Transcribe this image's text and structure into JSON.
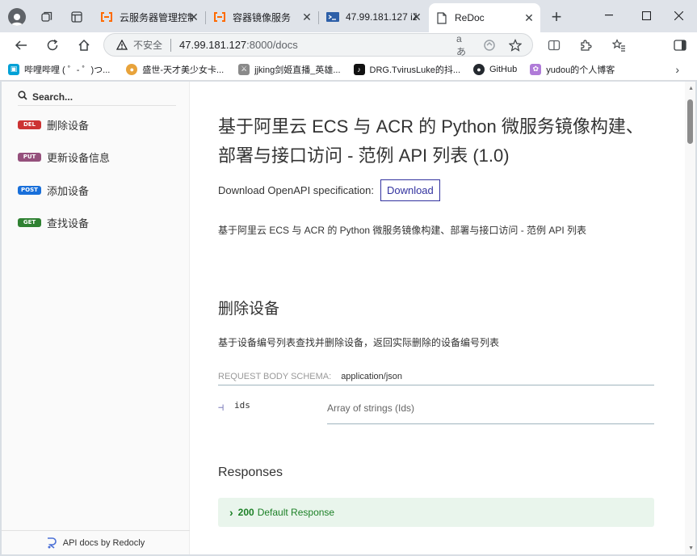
{
  "browser": {
    "tabs": [
      {
        "title": "云服务器管理控制台",
        "favicon": "aliyun-icon"
      },
      {
        "title": "容器镜像服务",
        "favicon": "aliyun-icon"
      },
      {
        "title": "47.99.181.127 iZb",
        "favicon": "terminal-icon"
      },
      {
        "title": "ReDoc",
        "favicon": "page-icon"
      }
    ],
    "insecure_label": "不安全",
    "url_host": "47.99.181.127",
    "url_path": ":8000/docs",
    "bookmarks": [
      {
        "label": "哔哩哔哩 ( ゜- ゜)つ...",
        "icon": "bilibili-icon",
        "color": "#00a1d6"
      },
      {
        "label": "盛世-天才美少女卡...",
        "icon": "avatar-icon",
        "color": "#e8a33b"
      },
      {
        "label": "jjking剑姬直播_英雄...",
        "icon": "sword-icon",
        "color": "#8a8a8a"
      },
      {
        "label": "DRG.TvirusLuke的抖...",
        "icon": "tiktok-icon",
        "color": "#111111"
      },
      {
        "label": "GitHub",
        "icon": "github-icon",
        "color": "#24292f"
      },
      {
        "label": "yudou的个人博客",
        "icon": "blog-icon",
        "color": "#b07bd8"
      }
    ]
  },
  "sidebar": {
    "search_placeholder": "Search...",
    "items": [
      {
        "method": "DEL",
        "label": "删除设备",
        "color": "#cc3333"
      },
      {
        "method": "PUT",
        "label": "更新设备信息",
        "color": "#95507c"
      },
      {
        "method": "POST",
        "label": "添加设备",
        "color": "#186fda"
      },
      {
        "method": "GET",
        "label": "查找设备",
        "color": "#2f8132"
      }
    ],
    "powered_by": "API docs by Redocly"
  },
  "content": {
    "title": "基于阿里云 ECS 与 ACR 的 Python 微服务镜像构建、部署与接口访问 - 范例 API 列表 (1.0)",
    "download_label": "Download OpenAPI specification:",
    "download_button": "Download",
    "description": "基于阿里云 ECS 与 ACR 的 Python 微服务镜像构建、部署与接口访问 - 范例 API 列表",
    "operation": {
      "title": "删除设备",
      "description": "基于设备编号列表查找并删除设备，返回实际删除的设备编号列表",
      "schema_label": "REQUEST BODY SCHEMA:",
      "schema_type": "application/json",
      "property_name": "ids",
      "property_type": "Array of strings (Ids)",
      "responses_title": "Responses",
      "response_code": "200",
      "response_text": "Default Response"
    }
  },
  "colors": {
    "link": "#32329f",
    "success": "#1d8127"
  }
}
